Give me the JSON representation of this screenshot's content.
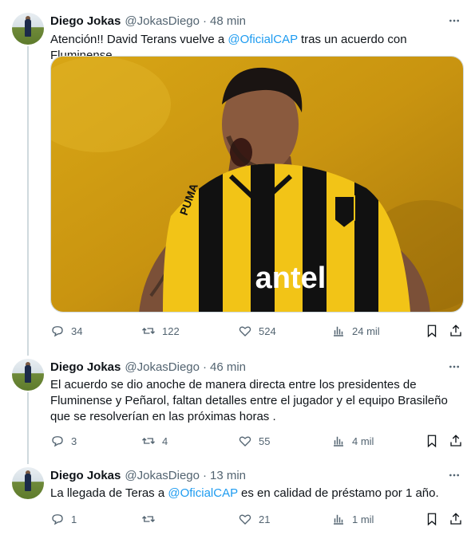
{
  "tweets": [
    {
      "name": "Diego Jokas",
      "handle": "@JokasDiego",
      "separator": "·",
      "time": "48 min",
      "text_parts": [
        "Atención!! David Terans vuelve a ",
        "@OficialCAP",
        " tras un acuerdo con Fluminense"
      ],
      "media": {
        "jersey_sponsor": "antel",
        "kit_brand": "PUMA",
        "jersey_colors": [
          "#f2c417",
          "#111111"
        ],
        "background_color": "#c99410"
      },
      "replies": "34",
      "retweets": "122",
      "likes": "524",
      "views": "24 mil"
    },
    {
      "name": "Diego Jokas",
      "handle": "@JokasDiego",
      "separator": "·",
      "time": "46 min",
      "text_lines": [
        "El acuerdo se dio anoche de manera directa entre los presidentes de",
        "Fluminense y Peñarol, faltan detalles entre el jugador y el equipo Brasileño",
        "que se resolverían en las próximas horas ."
      ],
      "replies": "3",
      "retweets": "4",
      "likes": "55",
      "views": "4 mil"
    },
    {
      "name": "Diego Jokas",
      "handle": "@JokasDiego",
      "separator": "·",
      "time": "13 min",
      "text_parts": [
        "La llegada de Teras a ",
        "@OficialCAP",
        " es en calidad de préstamo por 1 año."
      ],
      "replies": "1",
      "retweets": "",
      "likes": "21",
      "views": "1 mil"
    }
  ],
  "colors": {
    "text": "#0f1419",
    "secondary": "#536471",
    "link": "#1d9bf0",
    "thread_line": "#cfd9de"
  },
  "icons": [
    "reply-icon",
    "retweet-icon",
    "like-icon",
    "views-icon",
    "bookmark-icon",
    "share-icon",
    "more-icon"
  ]
}
